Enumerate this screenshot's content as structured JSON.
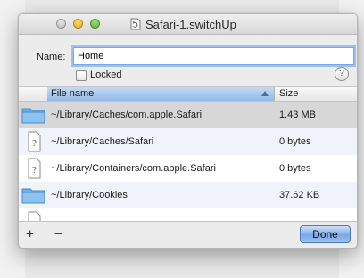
{
  "window": {
    "title": "Safari-1.switchUp"
  },
  "form": {
    "name_label": "Name:",
    "name_value": "Home",
    "locked_label": "Locked",
    "help_label": "?"
  },
  "table": {
    "columns": {
      "file_name": "File name",
      "size": "Size"
    },
    "rows": [
      {
        "path": "~/Library/Caches/com.apple.Safari",
        "size": "1.43 MB",
        "icon": "folder-icon"
      },
      {
        "path": "~/Library/Caches/Safari",
        "size": "0 bytes",
        "icon": "unknown-file-icon"
      },
      {
        "path": "~/Library/Containers/com.apple.Safari",
        "size": "0 bytes",
        "icon": "unknown-file-icon"
      },
      {
        "path": "~/Library/Cookies",
        "size": "37.62 KB",
        "icon": "folder-icon"
      }
    ]
  },
  "toolbar": {
    "add_label": "+",
    "remove_label": "−",
    "done_label": "Done"
  }
}
